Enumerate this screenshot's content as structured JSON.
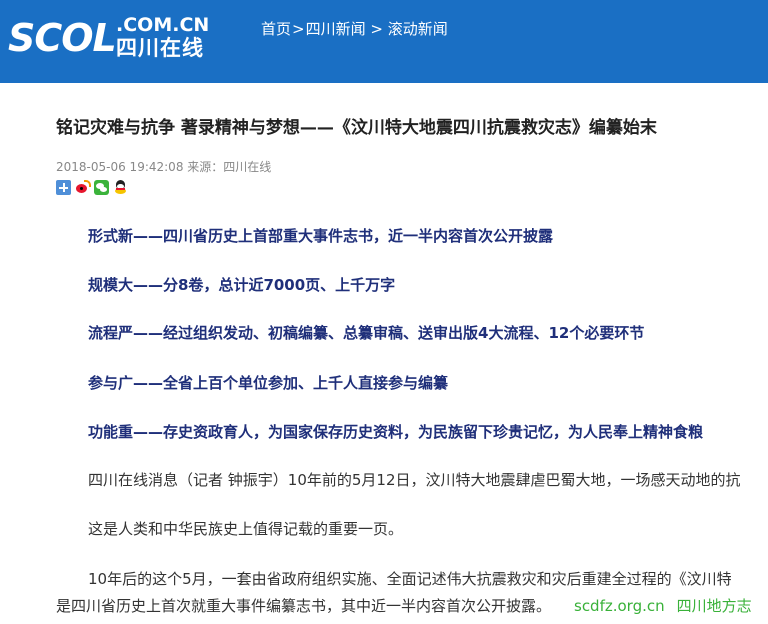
{
  "header": {
    "logo": {
      "main": "SCOL",
      "domain": ".COM.CN",
      "name": "四川在线"
    },
    "breadcrumb": [
      {
        "label": "首页"
      },
      {
        "label": "四川新闻"
      },
      {
        "label": "滚动新闻"
      }
    ],
    "separators": [
      ">",
      " > "
    ]
  },
  "article": {
    "title": "铭记灾难与抗争 著录精神与梦想——《汶川特大地震四川抗震救灾志》编纂始末",
    "meta": "2018-05-06 19:42:08 来源：四川在线",
    "share_icons": [
      "add-icon",
      "weibo-icon",
      "wechat-icon",
      "qq-icon"
    ],
    "highlights": [
      "形式新——四川省历史上首部重大事件志书，近一半内容首次公开披露",
      "规模大——分8卷，总计近7000页、上千万字",
      "流程严——经过组织发动、初稿编纂、总纂审稿、送审出版4大流程、12个必要环节",
      "参与广——全省上百个单位参加、上千人直接参与编纂",
      "功能重——存史资政育人，为国家保存历史资料，为民族留下珍贵记忆，为人民奉上精神食粮"
    ],
    "paragraphs": [
      "四川在线消息（记者 钟振宇）10年前的5月12日，汶川特大地震肆虐巴蜀大地，一场感天动地的抗",
      "这是人类和中华民族史上值得记载的重要一页。",
      "10年后的这个5月，一套由省政府组织实施、全面记述伟大抗震救灾和灾后重建全过程的《汶川特",
      "是四川省历史上首次就重大事件编纂志书，其中近一半内容首次公开披露。"
    ]
  },
  "watermark": {
    "url": "scdfz.org.cn",
    "name": "四川地方志"
  },
  "colors": {
    "header_bg": "#1a6fc4",
    "highlight_text": "#1f2f7a",
    "watermark": "#39b139"
  }
}
